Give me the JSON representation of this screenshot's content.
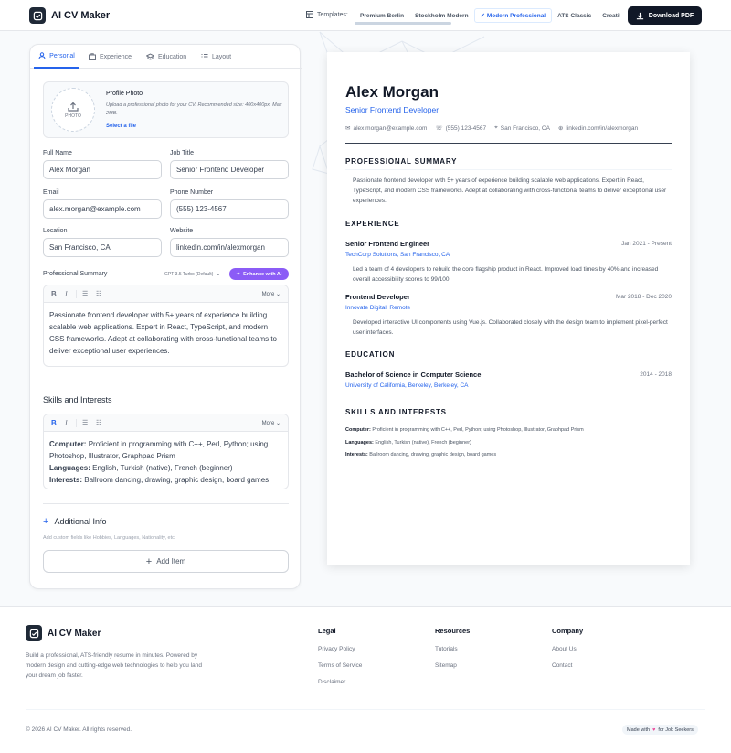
{
  "header": {
    "app_name": "AI CV Maker",
    "templates_label": "Templates:",
    "templates": [
      "Premium Berlin",
      "Stockholm Modern",
      "Modern Professional",
      "ATS Classic",
      "Creative Dark"
    ],
    "active_template": "Modern Professional",
    "download_label": "Download PDF"
  },
  "tabs": [
    "Personal",
    "Experience",
    "Education",
    "Layout"
  ],
  "active_tab": "Personal",
  "photo": {
    "placeholder": "PHOTO",
    "title": "Profile Photo",
    "description": "Upload a professional photo for your CV. Recommended size: 400x400px. Max 2MB.",
    "link": "Select a file"
  },
  "form": {
    "full_name": {
      "label": "Full Name",
      "value": "Alex Morgan"
    },
    "job_title": {
      "label": "Job Title",
      "value": "Senior Frontend Developer"
    },
    "email": {
      "label": "Email",
      "value": "alex.morgan@example.com"
    },
    "phone": {
      "label": "Phone Number",
      "value": "(555) 123-4567"
    },
    "location": {
      "label": "Location",
      "value": "San Francisco, CA"
    },
    "website": {
      "label": "Website",
      "value": "linkedin.com/in/alexmorgan"
    }
  },
  "summary": {
    "label": "Professional Summary",
    "model": "GPT-3.5 Turbo (Default)",
    "enhance_label": "Enhance with AI",
    "more_label": "More",
    "text": "Passionate frontend developer with 5+ years of experience building scalable web applications. Expert in React, TypeScript, and modern CSS frameworks. Adept at collaborating with cross-functional teams to deliver exceptional user experiences."
  },
  "skills_editor": {
    "title": "Skills and Interests",
    "more_label": "More",
    "lines": [
      {
        "key": "Computer:",
        "value": "Proficient in programming with C++, Perl, Python; using Photoshop, Illustrator, Graphpad Prism"
      },
      {
        "key": "Languages:",
        "value": "English, Turkish (native), French (beginner)"
      },
      {
        "key": "Interests:",
        "value": "Ballroom dancing, drawing, graphic design, board games"
      }
    ]
  },
  "additional": {
    "title": "Additional Info",
    "hint": "Add custom fields like Hobbies, Languages, Nationality, etc.",
    "add_label": "Add Item"
  },
  "resume": {
    "name": "Alex Morgan",
    "title": "Senior Frontend Developer",
    "email": "alex.morgan@example.com",
    "phone": "(555) 123-4567",
    "location": "San Francisco, CA",
    "website": "linkedin.com/in/alexmorgan",
    "summary_heading": "PROFESSIONAL SUMMARY",
    "summary": "Passionate frontend developer with 5+ years of experience building scalable web applications. Expert in React, TypeScript, and modern CSS frameworks. Adept at collaborating with cross-functional teams to deliver exceptional user experiences.",
    "experience_heading": "EXPERIENCE",
    "experience": [
      {
        "role": "Senior Frontend Engineer",
        "dates": "Jan 2021 - Present",
        "company": "TechCorp Solutions, San Francisco, CA",
        "desc": "Led a team of 4 developers to rebuild the core flagship product in React. Improved load times by 40% and increased overall accessibility scores to 99/100."
      },
      {
        "role": "Frontend Developer",
        "dates": "Mar 2018 - Dec 2020",
        "company": "Innovate Digital, Remote",
        "desc": "Developed interactive UI components using Vue.js. Collaborated closely with the design team to implement pixel-perfect user interfaces."
      }
    ],
    "education_heading": "EDUCATION",
    "education": {
      "degree": "Bachelor of Science in Computer Science",
      "dates": "2014 - 2018",
      "school": "University of California, Berkeley, Berkeley, CA"
    },
    "skills_heading": "SKILLS AND INTERESTS",
    "skills": [
      {
        "key": "Computer:",
        "value": "Proficient in programming with C++, Perl, Python; using Photoshop, Illustrator, Graphpad Prism"
      },
      {
        "key": "Languages:",
        "value": "English, Turkish (native), French (beginner)"
      },
      {
        "key": "Interests:",
        "value": "Ballroom dancing, drawing, graphic design, board games"
      }
    ]
  },
  "footer": {
    "app_name": "AI CV Maker",
    "description": "Build a professional, ATS-friendly resume in minutes. Powered by modern design and cutting-edge web technologies to help you land your dream job faster.",
    "columns": [
      {
        "title": "Legal",
        "links": [
          "Privacy Policy",
          "Terms of Service",
          "Disclaimer"
        ]
      },
      {
        "title": "Resources",
        "links": [
          "Tutorials",
          "Sitemap"
        ]
      },
      {
        "title": "Company",
        "links": [
          "About Us",
          "Contact"
        ]
      }
    ],
    "copyright": "© 2026 AI CV Maker. All rights reserved.",
    "made_with_before": "Made with",
    "made_with_after": "for Job Seekers"
  },
  "colors": {
    "accent": "#2563eb",
    "ai": "#8b5cf6",
    "dark": "#111827",
    "heart": "#ec4899"
  }
}
